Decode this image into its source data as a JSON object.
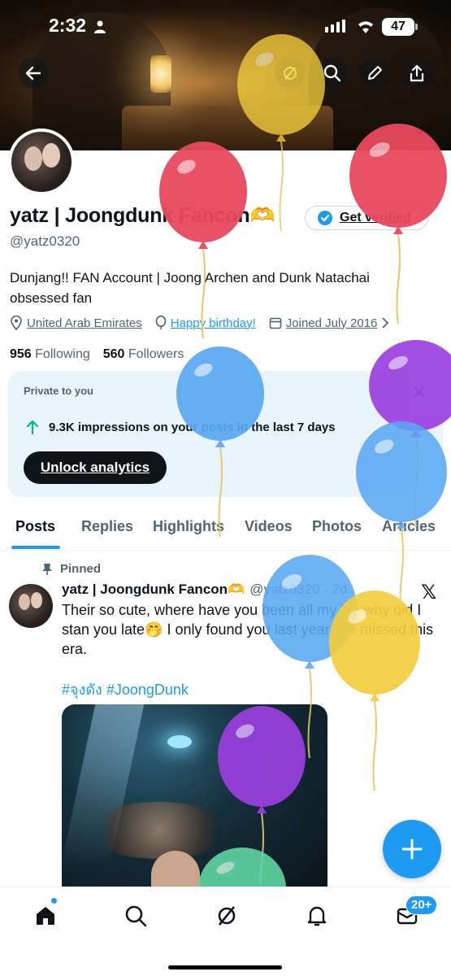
{
  "status_bar": {
    "time": "2:32",
    "battery": "47"
  },
  "profile": {
    "name": "yatz | Joongdunk Fancon🫶",
    "handle": "@yatz0320",
    "verify_label": "Get verified",
    "bio": "Dunjang!! FAN Account | Joong Archen and Dunk Natachai obsessed fan",
    "location": "United Arab Emirates",
    "birthday": "Happy birthday!",
    "joined": "Joined July 2016",
    "following_count": "956",
    "following_label": "Following",
    "followers_count": "560",
    "followers_label": "Followers"
  },
  "analytics_card": {
    "private_label": "Private to you",
    "impressions_text": "9.3K impressions on your posts in the last 7 days",
    "unlock_label": "Unlock analytics"
  },
  "tabs": [
    "Posts",
    "Replies",
    "Highlights",
    "Videos",
    "Photos",
    "Articles"
  ],
  "active_tab": "Posts",
  "pinned_post": {
    "pinned_label": "Pinned",
    "author": "yatz | Joongdunk Fancon🫶",
    "handle_time": "@yatz0320 · 2d",
    "text": "Their so cute, where have you been all my life why did I stan you late🤭 I only found you last year I've missed this era.",
    "hashtags": "#จุงดัง #JoongDunk"
  },
  "bottom_nav": {
    "messages_badge": "20+"
  },
  "icons": {
    "back": "back-arrow-icon",
    "grok": "grok-icon",
    "search": "search-icon",
    "edit": "edit-icon",
    "share": "share-icon",
    "verified": "verified-badge-icon",
    "location": "location-pin-icon",
    "birthday": "balloon-icon",
    "calendar": "calendar-icon",
    "trend": "arrow-up-icon",
    "close": "close-icon",
    "pin": "pin-icon",
    "x": "x-logo-icon",
    "compose": "plus-icon",
    "home": "home-icon",
    "notifications": "bell-icon",
    "messages": "mail-icon"
  },
  "colors": {
    "accent": "#1d9bf0",
    "text": "#0f1419",
    "muted": "#536471",
    "card_bg": "#e8f5fd"
  },
  "balloon_overlay": {
    "colors": [
      "#f4ce3e",
      "#e8485e",
      "#e8485e",
      "#5aa8f2",
      "#9b3fe0",
      "#5aa8f2",
      "#5aa8f2",
      "#f4ce3e",
      "#9b3fe0",
      "#5fd6a4"
    ]
  }
}
